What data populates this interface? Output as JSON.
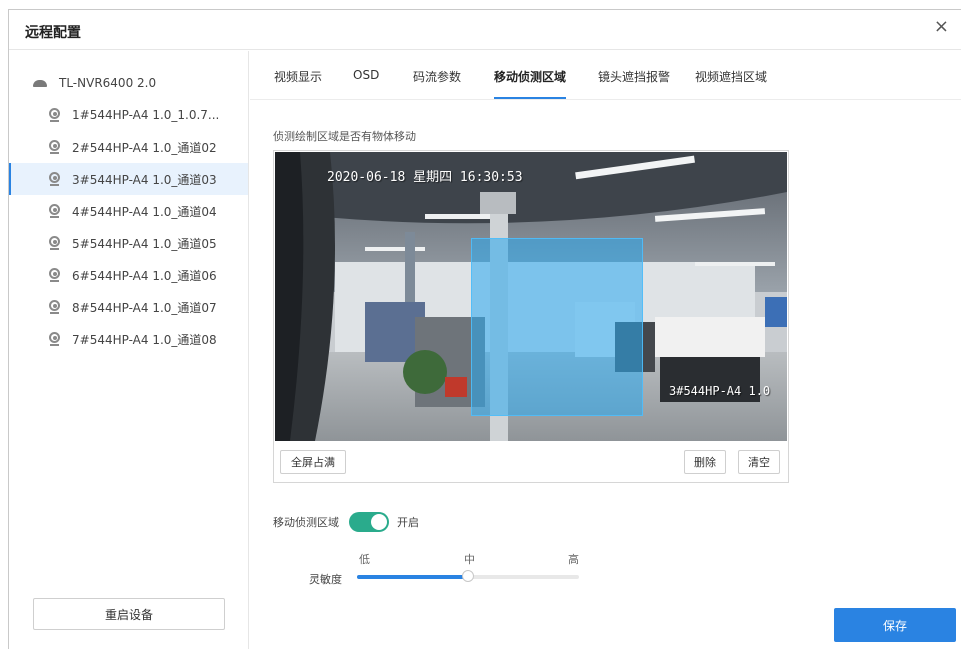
{
  "window": {
    "title": "远程配置",
    "close_symbol": "×"
  },
  "sidebar": {
    "device": "TL-NVR6400 2.0",
    "channels": [
      "1#544HP-A4 1.0_1.0.7...",
      "2#544HP-A4 1.0_通道02",
      "3#544HP-A4 1.0_通道03",
      "4#544HP-A4 1.0_通道04",
      "5#544HP-A4 1.0_通道05",
      "6#544HP-A4 1.0_通道06",
      "8#544HP-A4 1.0_通道07",
      "7#544HP-A4 1.0_通道08"
    ],
    "selected_index": 2,
    "reboot_label": "重启设备"
  },
  "tabs": [
    "视频显示",
    "OSD",
    "码流参数",
    "移动侦测区域",
    "镜头遮挡报警",
    "视频遮挡区域"
  ],
  "active_tab": 3,
  "content": {
    "hint": "侦测绘制区域是否有物体移动",
    "osd_time": "2020-06-18 星期四 16:30:53",
    "osd_name": "3#544HP-A4 1.0",
    "fullscreen_label": "全屏占满",
    "delete_label": "删除",
    "clear_label": "清空",
    "motion_label": "移动侦测区域",
    "motion_state": "开启",
    "motion_enabled": true,
    "sensitivity_label": "灵敏度",
    "scale_low": "低",
    "scale_mid": "中",
    "scale_high": "高",
    "sensitivity_fraction": 0.5
  },
  "save_label": "保存",
  "colors": {
    "accent": "#2a83e2",
    "toggle_on": "#2aab8c",
    "detect_area": "#2aaaf0"
  }
}
